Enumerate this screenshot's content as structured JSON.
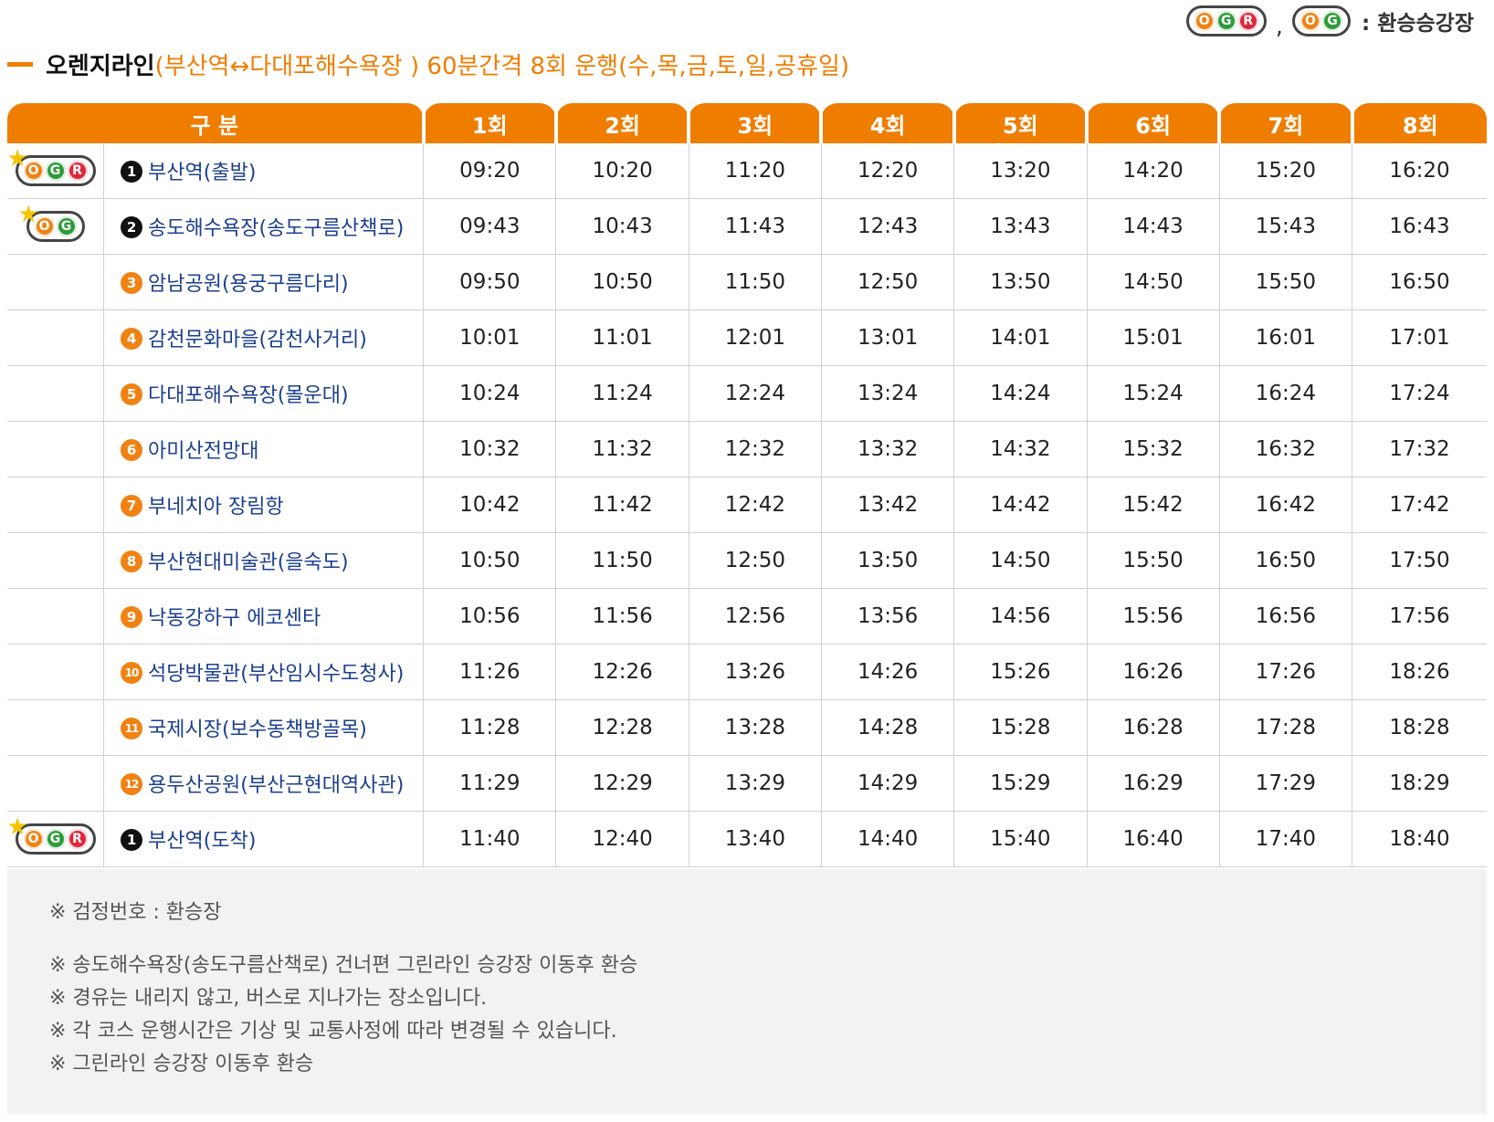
{
  "legend": {
    "badges": [
      [
        "O",
        "G",
        "R"
      ],
      [
        "O",
        "G"
      ]
    ],
    "comma": ",",
    "text": ": 환승승강장"
  },
  "title": {
    "main": "오렌지라인",
    "sub": "(부산역↔다대포해수욕장 ) 60분간격 8회 운행(수,목,금,토,일,공휴일)"
  },
  "table": {
    "headers": [
      "구 분",
      "1회",
      "2회",
      "3회",
      "4회",
      "5회",
      "6회",
      "7회",
      "8회"
    ],
    "rows": [
      {
        "badge": "OGR",
        "num": "1",
        "numStyle": "black",
        "stop": "부산역(출발)",
        "times": [
          "09:20",
          "10:20",
          "11:20",
          "12:20",
          "13:20",
          "14:20",
          "15:20",
          "16:20"
        ]
      },
      {
        "badge": "OG",
        "num": "2",
        "numStyle": "black",
        "stop": "송도해수욕장(송도구름산책로)",
        "times": [
          "09:43",
          "10:43",
          "11:43",
          "12:43",
          "13:43",
          "14:43",
          "15:43",
          "16:43"
        ]
      },
      {
        "badge": "",
        "num": "3",
        "numStyle": "orange",
        "stop": "암남공원(용궁구름다리)",
        "times": [
          "09:50",
          "10:50",
          "11:50",
          "12:50",
          "13:50",
          "14:50",
          "15:50",
          "16:50"
        ]
      },
      {
        "badge": "",
        "num": "4",
        "numStyle": "orange",
        "stop": "감천문화마을(감천사거리)",
        "times": [
          "10:01",
          "11:01",
          "12:01",
          "13:01",
          "14:01",
          "15:01",
          "16:01",
          "17:01"
        ]
      },
      {
        "badge": "",
        "num": "5",
        "numStyle": "orange",
        "stop": "다대포해수욕장(몰운대)",
        "times": [
          "10:24",
          "11:24",
          "12:24",
          "13:24",
          "14:24",
          "15:24",
          "16:24",
          "17:24"
        ]
      },
      {
        "badge": "",
        "num": "6",
        "numStyle": "orange",
        "stop": "아미산전망대",
        "times": [
          "10:32",
          "11:32",
          "12:32",
          "13:32",
          "14:32",
          "15:32",
          "16:32",
          "17:32"
        ]
      },
      {
        "badge": "",
        "num": "7",
        "numStyle": "orange",
        "stop": "부네치아 장림항",
        "times": [
          "10:42",
          "11:42",
          "12:42",
          "13:42",
          "14:42",
          "15:42",
          "16:42",
          "17:42"
        ]
      },
      {
        "badge": "",
        "num": "8",
        "numStyle": "orange",
        "stop": "부산현대미술관(을숙도)",
        "times": [
          "10:50",
          "11:50",
          "12:50",
          "13:50",
          "14:50",
          "15:50",
          "16:50",
          "17:50"
        ]
      },
      {
        "badge": "",
        "num": "9",
        "numStyle": "orange",
        "stop": "낙동강하구 에코센타",
        "times": [
          "10:56",
          "11:56",
          "12:56",
          "13:56",
          "14:56",
          "15:56",
          "16:56",
          "17:56"
        ]
      },
      {
        "badge": "",
        "num": "10",
        "numStyle": "orange",
        "stop": "석당박물관(부산임시수도청사)",
        "times": [
          "11:26",
          "12:26",
          "13:26",
          "14:26",
          "15:26",
          "16:26",
          "17:26",
          "18:26"
        ]
      },
      {
        "badge": "",
        "num": "11",
        "numStyle": "orange",
        "stop": "국제시장(보수동책방골목)",
        "times": [
          "11:28",
          "12:28",
          "13:28",
          "14:28",
          "15:28",
          "16:28",
          "17:28",
          "18:28"
        ]
      },
      {
        "badge": "",
        "num": "12",
        "numStyle": "orange",
        "stop": "용두산공원(부산근현대역사관)",
        "times": [
          "11:29",
          "12:29",
          "13:29",
          "14:29",
          "15:29",
          "16:29",
          "17:29",
          "18:29"
        ]
      },
      {
        "badge": "OGR",
        "num": "1",
        "numStyle": "black",
        "stop": "부산역(도착)",
        "times": [
          "11:40",
          "12:40",
          "13:40",
          "14:40",
          "15:40",
          "16:40",
          "17:40",
          "18:40"
        ]
      }
    ]
  },
  "notes": [
    "※ 검정번호 : 환승장",
    "※ 송도해수욕장(송도구름산책로) 건너편 그린라인 승강장 이동후 환승",
    "※ 경유는 내리지 않고, 버스로 지나가는 장소입니다.",
    "※ 각 코스 운행시간은 기상 및 교통사정에 따라 변경될 수 있습니다.",
    "※ 그린라인 승강장 이동후 환승"
  ],
  "colors": {
    "accent": "#ef7d00",
    "orange_dot": "#f08213",
    "green_dot": "#2e9b3a",
    "red_dot": "#e0263b",
    "stop_text": "#1b3f8f"
  },
  "icons": {
    "legend_star": "star-icon",
    "badge": "transfer-badge-icon"
  }
}
